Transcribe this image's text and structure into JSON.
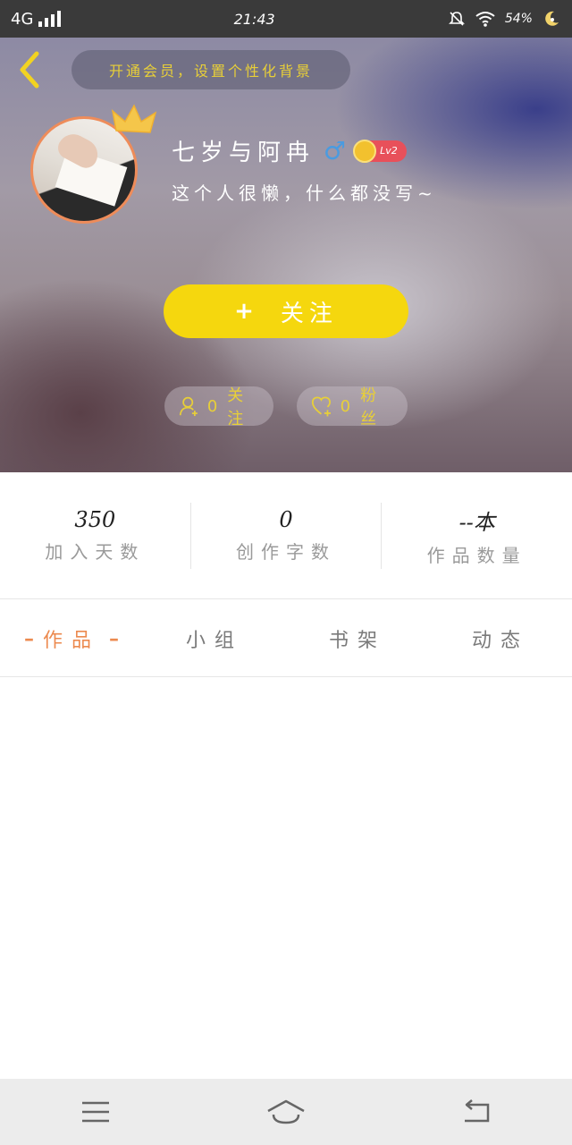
{
  "status_bar": {
    "network": "4G",
    "time": "21:43",
    "battery": "54%",
    "icons": [
      "signal-icon",
      "mute-icon",
      "wifi-icon",
      "moon-icon"
    ]
  },
  "header": {
    "back_icon": "chevron-left-icon",
    "background_tip": "开通会员，设置个性化背景"
  },
  "profile": {
    "username": "七岁与阿冉",
    "gender_icon": "male-icon",
    "gender_symbol": "♂",
    "level": "Lv2",
    "bio": "这个人很懒，什么都没写~"
  },
  "follow_button": {
    "plus": "+",
    "label": "关注"
  },
  "chips": {
    "following_count": "0",
    "following_label": "关注",
    "fans_count": "0",
    "fans_label": "粉丝"
  },
  "stats": [
    {
      "value": "350",
      "label": "加入天数"
    },
    {
      "value": "0",
      "label": "创作字数"
    },
    {
      "value": "--本",
      "label": "作品数量"
    }
  ],
  "tabs": [
    {
      "label": "作品",
      "active": true
    },
    {
      "label": "小组",
      "active": false
    },
    {
      "label": "书架",
      "active": false
    },
    {
      "label": "动态",
      "active": false
    }
  ],
  "colors": {
    "accent_yellow": "#f5d70e",
    "tip_text": "#e8cf38",
    "active_tab": "#ec8a4f",
    "avatar_border": "#ee8c5a",
    "level_badge": "#e8505a",
    "male_icon": "#4a9be0"
  },
  "navbar": {
    "icons": [
      "menu-icon",
      "home-icon",
      "back-icon"
    ]
  }
}
